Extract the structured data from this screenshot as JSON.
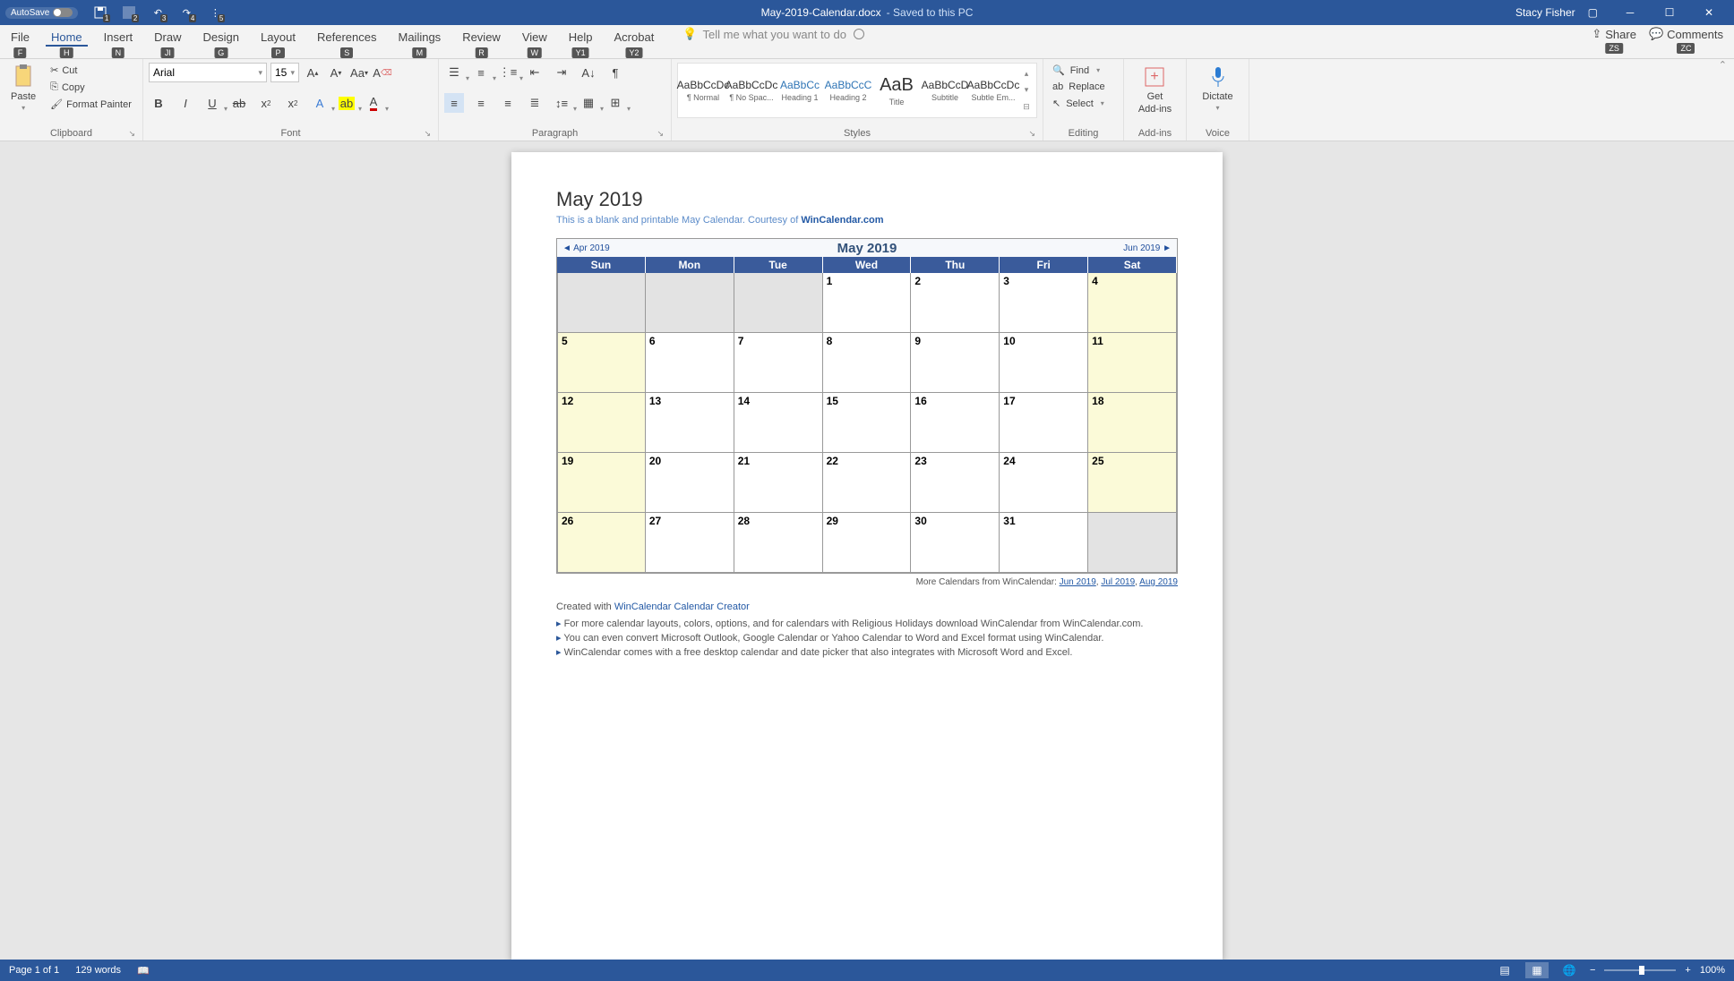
{
  "titlebar": {
    "autosave_label": "AutoSave",
    "doc_name": "May-2019-Calendar.docx",
    "save_state": "Saved to this PC",
    "user": "Stacy Fisher"
  },
  "qat": {
    "keys": [
      "1",
      "2",
      "3",
      "4",
      "5"
    ]
  },
  "tabs": {
    "items": [
      {
        "label": "File",
        "key": "F"
      },
      {
        "label": "Home",
        "key": "H"
      },
      {
        "label": "Insert",
        "key": "N"
      },
      {
        "label": "Draw",
        "key": "JI"
      },
      {
        "label": "Design",
        "key": "G"
      },
      {
        "label": "Layout",
        "key": "P"
      },
      {
        "label": "References",
        "key": "S"
      },
      {
        "label": "Mailings",
        "key": "M"
      },
      {
        "label": "Review",
        "key": "R"
      },
      {
        "label": "View",
        "key": "W"
      },
      {
        "label": "Help",
        "key": "Y1"
      },
      {
        "label": "Acrobat",
        "key": "Y2"
      }
    ],
    "tell_me": "Tell me what you want to do",
    "share": "Share",
    "share_key": "ZS",
    "comments": "Comments",
    "comments_key": "ZC"
  },
  "clipboard": {
    "paste": "Paste",
    "cut": "Cut",
    "copy": "Copy",
    "fmt": "Format Painter",
    "group": "Clipboard"
  },
  "font": {
    "name": "Arial",
    "size": "15",
    "group": "Font"
  },
  "paragraph": {
    "group": "Paragraph"
  },
  "styles": {
    "items": [
      {
        "prev": "AaBbCcDc",
        "label": "¶ Normal"
      },
      {
        "prev": "AaBbCcDc",
        "label": "¶ No Spac..."
      },
      {
        "prev": "AaBbCc",
        "label": "Heading 1",
        "cls": "h1"
      },
      {
        "prev": "AaBbCcC",
        "label": "Heading 2",
        "cls": "h2"
      },
      {
        "prev": "AaB",
        "label": "Title",
        "cls": "title"
      },
      {
        "prev": "AaBbCcD",
        "label": "Subtitle"
      },
      {
        "prev": "AaBbCcDc",
        "label": "Subtle Em..."
      }
    ],
    "group": "Styles"
  },
  "editing": {
    "find": "Find",
    "replace": "Replace",
    "select": "Select",
    "group": "Editing"
  },
  "addins": {
    "get1": "Get",
    "get2": "Add-ins",
    "group": "Add-ins"
  },
  "voice": {
    "dictate": "Dictate",
    "group": "Voice"
  },
  "document": {
    "heading": "May 2019",
    "sub_pre": "This is a blank and printable May Calendar.  Courtesy of ",
    "sub_link": "WinCalendar.com",
    "cal_title": "May   2019",
    "prev_nav": "◄ Apr 2019",
    "next_nav": "Jun 2019 ►",
    "dow": [
      "Sun",
      "Mon",
      "Tue",
      "Wed",
      "Thu",
      "Fri",
      "Sat"
    ],
    "more_pre": "More Calendars from WinCalendar: ",
    "more_links": [
      "Jun 2019",
      "Jul 2019",
      "Aug 2019"
    ],
    "created_pre": "Created with ",
    "created_link": "WinCalendar Calendar Creator",
    "bullets": [
      "For more calendar layouts, colors, options, and for calendars with Religious Holidays download WinCalendar from WinCalendar.com.",
      "You can even convert Microsoft Outlook, Google Calendar or Yahoo Calendar to Word and Excel format using WinCalendar.",
      "WinCalendar comes with a free desktop calendar and date picker that also integrates with Microsoft Word and Excel."
    ]
  },
  "chart_data": {
    "type": "table",
    "title": "May 2019",
    "columns": [
      "Sun",
      "Mon",
      "Tue",
      "Wed",
      "Thu",
      "Fri",
      "Sat"
    ],
    "rows": [
      [
        "",
        "",
        "",
        "1",
        "2",
        "3",
        "4"
      ],
      [
        "5",
        "6",
        "7",
        "8",
        "9",
        "10",
        "11"
      ],
      [
        "12",
        "13",
        "14",
        "15",
        "16",
        "17",
        "18"
      ],
      [
        "19",
        "20",
        "21",
        "22",
        "23",
        "24",
        "25"
      ],
      [
        "26",
        "27",
        "28",
        "29",
        "30",
        "31",
        ""
      ]
    ]
  },
  "statusbar": {
    "page": "Page 1 of 1",
    "words": "129 words",
    "zoom": "100%"
  }
}
